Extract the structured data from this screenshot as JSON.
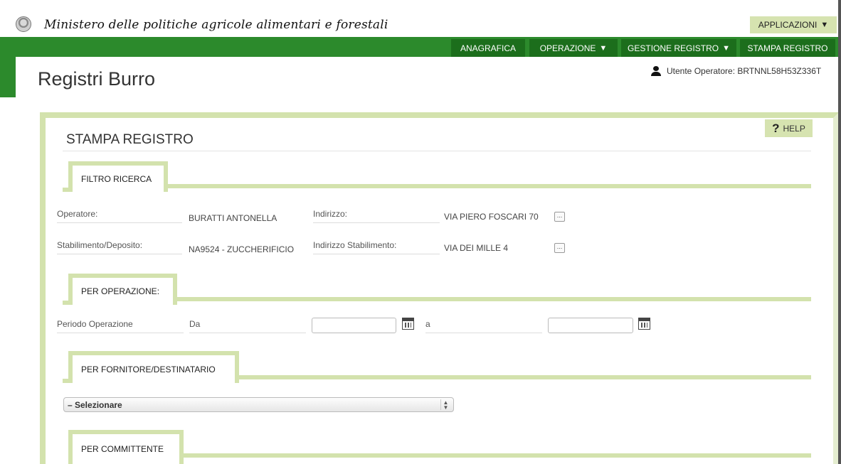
{
  "header": {
    "ministry": "Ministero delle politiche agricole alimentari e forestali",
    "applications_label": "APPLICAZIONI"
  },
  "nav": {
    "anagrafica": "ANAGRAFICA",
    "operazione": "OPERAZIONE",
    "gestione_registro": "GESTIONE REGISTRO",
    "stampa_registro": "STAMPA REGISTRO"
  },
  "page": {
    "title": "Registri Burro",
    "user": "Utente Operatore: BRTNNL58H53Z336T",
    "section_title": "STAMPA REGISTRO",
    "help": "HELP"
  },
  "filtro": {
    "tab": "FILTRO RICERCA",
    "operatore_label": "Operatore:",
    "operatore_value": "BURATTI ANTONELLA",
    "indirizzo_label": "Indirizzo:",
    "indirizzo_value": "VIA PIERO FOSCARI 70",
    "stabilimento_label": "Stabilimento/Deposito:",
    "stabilimento_value": "NA9524 - ZUCCHERIFICIO",
    "indirizzo_stab_label": "Indirizzo Stabilimento:",
    "indirizzo_stab_value": "VIA DEI MILLE 4",
    "more_button": "..."
  },
  "per_operazione": {
    "tab": "PER OPERAZIONE:",
    "periodo_label": "Periodo Operazione",
    "da_label": "Da",
    "a_label": "a",
    "da_value": "",
    "a_value": ""
  },
  "per_fornitore": {
    "tab": "PER FORNITORE/DESTINATARIO",
    "selected": "– Selezionare"
  },
  "per_committente": {
    "tab": "PER COMMITTENTE"
  },
  "colors": {
    "nav_green": "#2c8a2c",
    "nav_item_dark": "#1c6e1c",
    "accent_light_green": "#d3e2ad"
  }
}
